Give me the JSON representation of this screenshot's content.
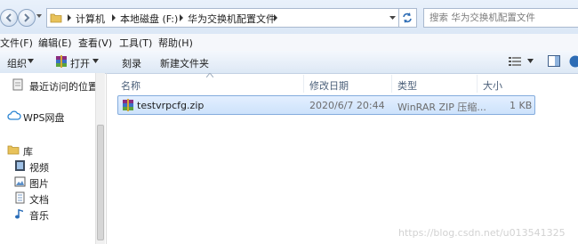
{
  "address_bar": {
    "crumbs": [
      "计算机",
      "本地磁盘 (F:)",
      "华为交换机配置文件"
    ],
    "search_placeholder": "搜索 华为交换机配置文件"
  },
  "menu": [
    "文件(F)",
    "编辑(E)",
    "查看(V)",
    "工具(T)",
    "帮助(H)"
  ],
  "commands": {
    "organize": "组织",
    "open": "打开",
    "burn": "刻录",
    "new_folder": "新建文件夹"
  },
  "nav_pane": {
    "items": [
      {
        "label": "最近访问的位置",
        "icon": "recent-places-icon"
      },
      {
        "label": "WPS网盘",
        "icon": "cloud-icon"
      },
      {
        "label": "库",
        "icon": "library-icon"
      },
      {
        "label": "视频",
        "icon": "video-icon"
      },
      {
        "label": "图片",
        "icon": "picture-icon"
      },
      {
        "label": "文档",
        "icon": "document-icon"
      },
      {
        "label": "音乐",
        "icon": "music-icon"
      }
    ]
  },
  "columns": [
    "名称",
    "修改日期",
    "类型",
    "大小"
  ],
  "files": [
    {
      "name": "testvrpcfg.zip",
      "modified": "2020/6/7 20:44",
      "type": "WinRAR ZIP 压缩...",
      "size": "1 KB",
      "icon": "winrar-zip-icon"
    }
  ],
  "watermark": "https://blog.csdn.net/u013541325",
  "colors": {
    "selection": "#cde2fb",
    "selection_border": "#84acdd",
    "toolbar": "#dde8f5"
  }
}
